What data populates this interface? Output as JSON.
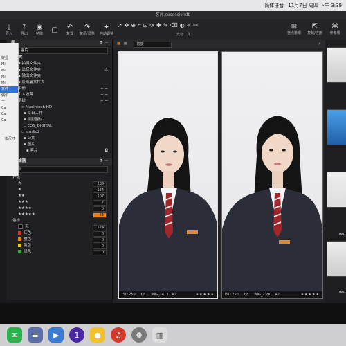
{
  "menubar": {
    "items": [
      "简体拼音",
      "11月7日 周四 下午 3:39"
    ]
  },
  "window": {
    "title": "客片.cosessiondb"
  },
  "toolbar": {
    "buttons": [
      {
        "icon": "import-icon",
        "label": "导入"
      },
      {
        "icon": "export-icon",
        "label": "导出"
      },
      {
        "icon": "camera-icon",
        "label": "拍摄"
      },
      {
        "icon": "blank",
        "label": ""
      },
      {
        "icon": "undo-icon",
        "label": "复置"
      },
      {
        "icon": "redo-icon",
        "label": "复原/调整"
      },
      {
        "icon": "auto-icon",
        "label": "自动调整"
      }
    ],
    "tools_label": "光标工具",
    "right_buttons": [
      {
        "icon": "grid-icon",
        "label": "查点道眼"
      },
      {
        "icon": "copy-icon",
        "label": "复制/应用"
      },
      {
        "icon": "ref-icon",
        "label": "参考线"
      }
    ]
  },
  "popover": {
    "items": [
      "",
      "",
      "好显",
      "Mi",
      "Mi",
      "Mi",
      "Mi",
      "文件",
      "偶尔",
      "一",
      "Ca",
      "Ca",
      "Ca",
      "",
      "",
      "一指尺寸"
    ],
    "selected_index": 7
  },
  "library": {
    "header": "库",
    "current": "客片",
    "folders_header": "文件夹",
    "folders": [
      "拍摄文件夹",
      "选择文件夹",
      "输出文件夹",
      "废纸篓文件夹"
    ],
    "albums_header": "相册",
    "favorites_header": "个人收藏",
    "system_header": "系统",
    "system_items": [
      "Macintosh HD",
      "每日工作",
      "摄影器材",
      "EOS_DIGITAL",
      "studio2",
      "公共",
      "图片",
      "客片"
    ]
  },
  "filter": {
    "header": "过滤器",
    "search_placeholder": "搜索",
    "rating_header": "评级",
    "ratings": [
      {
        "label": "无",
        "count": "283"
      },
      {
        "label": "★",
        "count": "124"
      },
      {
        "label": "★★",
        "count": "107"
      },
      {
        "label": "★★★",
        "count": "7"
      },
      {
        "label": "★★★★",
        "count": "0"
      },
      {
        "label": "★★★★★",
        "count": "23"
      }
    ],
    "color_header": "色标",
    "colors": [
      {
        "label": "无",
        "count": "524",
        "color": "#000000"
      },
      {
        "label": "红色",
        "count": "0",
        "color": "#d33a2c"
      },
      {
        "label": "橙色",
        "count": "0",
        "color": "#e8831e"
      },
      {
        "label": "黄色",
        "count": "0",
        "color": "#e3c71f"
      },
      {
        "label": "绿色",
        "count": "0",
        "color": "#3aa93a"
      }
    ]
  },
  "viewer": {
    "background_label": "背景",
    "photos": [
      {
        "iso": "ISO 250",
        "aperture": "f/8",
        "name": "IMG_2413.CR2",
        "stars": "★★★★★"
      },
      {
        "iso": "ISO 250",
        "aperture": "f/8",
        "name": "IMG_2390.CR2",
        "stars": "★★★★★"
      }
    ]
  },
  "filmstrip": {
    "labels": [
      "IMG",
      "IMG"
    ]
  },
  "dock": {
    "apps": [
      {
        "name": "wechat",
        "color": "#2bb24c",
        "glyph": "✉"
      },
      {
        "name": "notes",
        "color": "#5b6ea8",
        "glyph": "≡"
      },
      {
        "name": "tiktok",
        "color": "#3a7bd5",
        "glyph": "▶"
      },
      {
        "name": "app-one",
        "color": "#4a2aa0",
        "glyph": "1"
      },
      {
        "name": "app-yellow",
        "color": "#f2c22e",
        "glyph": "●"
      },
      {
        "name": "netease",
        "color": "#d33a2c",
        "glyph": "♫"
      },
      {
        "name": "settings",
        "color": "#7a7a7a",
        "glyph": "⚙"
      },
      {
        "name": "trash",
        "color": "#dcdcdc",
        "glyph": "🗑"
      }
    ]
  }
}
